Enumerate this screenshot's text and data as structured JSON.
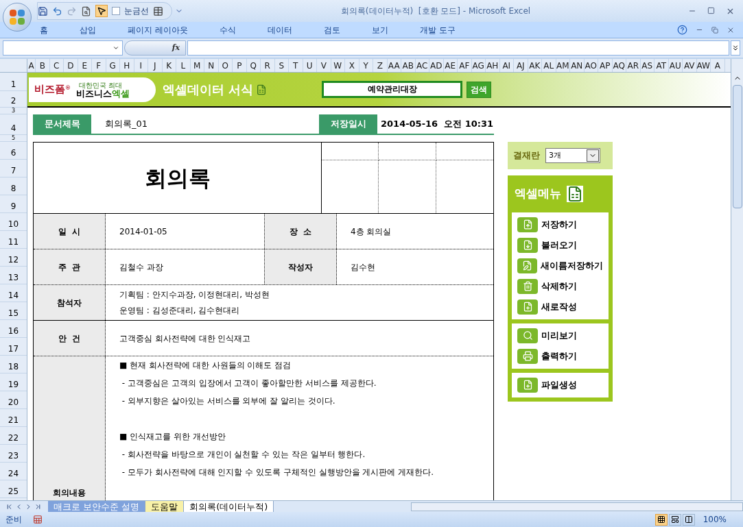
{
  "window": {
    "title": "회의록(데이터누적)  [호환 모드] - Microsoft Excel"
  },
  "quick_access": {
    "gridlines": {
      "label": "눈금선",
      "checked": false
    },
    "pointer_selected": true
  },
  "ribbon_tabs": [
    "홈",
    "삽입",
    "페이지 레이아웃",
    "수식",
    "데이터",
    "검토",
    "보기",
    "개발 도구"
  ],
  "formula_bar": {
    "fx": "fx"
  },
  "columns": [
    "A",
    "B",
    "C",
    "D",
    "E",
    "F",
    "G",
    "H",
    "I",
    "J",
    "K",
    "L",
    "M",
    "N",
    "O",
    "P",
    "Q",
    "R",
    "S",
    "T",
    "U",
    "V",
    "W",
    "X",
    "Y",
    "Z",
    "AA",
    "AB",
    "AC",
    "AD",
    "AE",
    "AF",
    "AG",
    "AH",
    "AI",
    "AJ",
    "AK",
    "AL",
    "AM",
    "AN",
    "AO",
    "AP",
    "AQ",
    "AR",
    "AS",
    "AT",
    "AU",
    "AV",
    "AW",
    "A"
  ],
  "rows": [
    "1",
    "2",
    "3",
    "4",
    "5",
    "6",
    "7",
    "8",
    "9",
    "10",
    "11",
    "12",
    "13",
    "14",
    "15",
    "16",
    "17",
    "18",
    "19",
    "20",
    "21",
    "22",
    "23",
    "24",
    "25"
  ],
  "banner": {
    "brand": "비즈폼",
    "brand_mark": "®",
    "tagline": "대한민국 최대",
    "brand2": "비즈니스",
    "brand2_accent": "엑셀",
    "title": "엑셀데이터 서식",
    "search_value": "예약관리대장",
    "search_button": "검색"
  },
  "doc_info": {
    "title_label": "문서제목",
    "title_value": "회의록_01",
    "saved_label": "저장일시",
    "saved_value": "2014-05-16  오전 10:31"
  },
  "form": {
    "title": "회의록",
    "fields": [
      {
        "label": "일  시",
        "value": "2014-01-05",
        "label2": "장  소",
        "value2": "4층 회의실"
      },
      {
        "label": "주  관",
        "value": "김철수 과장",
        "label2": "작성자",
        "value2": "김수현"
      }
    ],
    "attendees": {
      "label": "참석자",
      "lines": [
        "기획팀 : 안지수과장, 이정현대리, 박성현",
        "운영팀 : 김성준대리, 김수현대리"
      ]
    },
    "agenda": {
      "label": "안  건",
      "value": "고객중심 회사전략에 대한 인식재고"
    },
    "minutes": {
      "label": "회의내용",
      "sections": [
        [
          "■ 현재 회사전략에 대한 사원들의 이해도 점검",
          " - 고객중심은 고객의 입장에서 고객이 좋아할만한 서비스를 제공한다.",
          " - 외부지향은 살아있는 서비스를 외부에 잘 알리는 것이다."
        ],
        [
          "■ 인식재고를 위한 개선방안",
          " - 회사전략을 바탕으로 개인이 실천할 수 있는 작은 일부터 행한다.",
          " - 모두가 회사전략에 대해 인지할 수 있도록 구체적인 실행방안을 게시판에 게재한다."
        ]
      ]
    }
  },
  "approval": {
    "label": "결재란",
    "value": "3개"
  },
  "excel_menu": {
    "title": "엑셀메뉴",
    "groups": [
      [
        "저장하기",
        "불러오기",
        "새이름저장하기",
        "삭제하기",
        "새로작성"
      ],
      [
        "미리보기",
        "출력하기"
      ],
      [
        "파일생성"
      ]
    ]
  },
  "sheet_tabs": [
    {
      "label": "매크로 보안수준 설명",
      "selected": false
    },
    {
      "label": "도움말",
      "selected": false
    },
    {
      "label": "회의록(데이터누적)",
      "selected": true
    }
  ],
  "status_bar": {
    "text": "준비",
    "zoom": "100%",
    "views": [
      {
        "selected": true
      },
      {
        "selected": false
      },
      {
        "selected": false
      }
    ]
  }
}
